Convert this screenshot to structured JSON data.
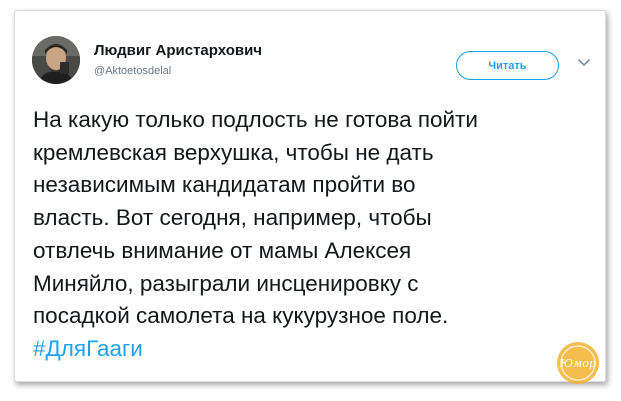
{
  "tweet": {
    "author": {
      "display_name": "Людвиг Аристархович",
      "handle": "@Aktoetosdelal"
    },
    "follow_label": "Читать",
    "menu_icon": "chevron-down-icon",
    "text_lines": [
      "На какую только подлость не готова пойти",
      "кремлевская верхушка, чтобы не дать",
      "независимым кандидатам пройти во",
      "власть. Вот сегодня, например, чтобы",
      "отвлечь внимание от мамы Алексея",
      "Миняйло, разыграли инсценировку с",
      "посадкой самолета на кукурузное поле."
    ],
    "hashtag": "#ДляГааги"
  },
  "watermark": {
    "text": "Юмор"
  },
  "colors": {
    "accent": "#1da1f2",
    "text": "#14171a",
    "muted": "#657786",
    "watermark": "#f0a020"
  }
}
